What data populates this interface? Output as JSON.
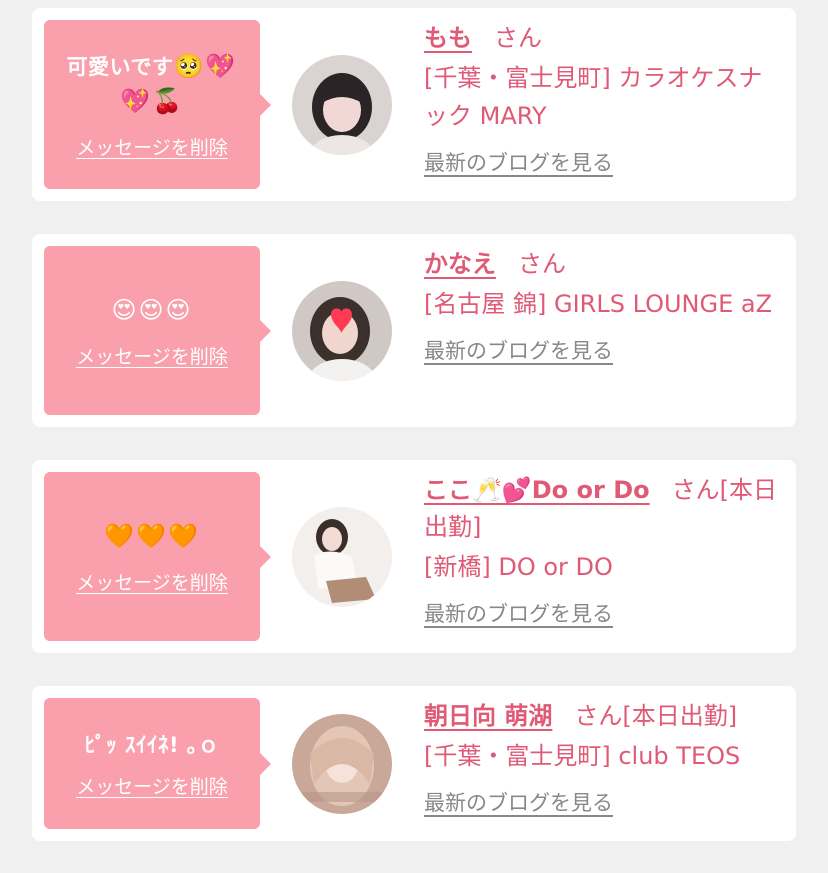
{
  "messages": [
    {
      "message_text": "可愛いです",
      "message_emoji": "🥺💖",
      "message_emoji2": "💖🍒",
      "delete_label": "メッセージを削除",
      "name": "もも",
      "honorific": "さん",
      "shop": "[千葉・富士見町] カラオケスナック MARY",
      "blog_link": "最新のブログを見る"
    },
    {
      "message_emoji": "😍😍😍",
      "delete_label": "メッセージを削除",
      "name": "かなえ",
      "honorific": "さん",
      "shop": "[名古屋 錦] GIRLS LOUNGE aZ",
      "blog_link": "最新のブログを見る"
    },
    {
      "message_emoji": "🧡🧡🧡",
      "delete_label": "メッセージを削除",
      "name": "ここ🥂💕Do or Do",
      "honorific": "さん[本日出勤]",
      "shop": "[新橋] DO or DO",
      "blog_link": "最新のブログを見る"
    },
    {
      "message_text": "ﾋﾟｯ ｽｲｲﾈ! ｡ｏ",
      "delete_label": "メッセージを削除",
      "name": "朝日向 萌湖",
      "honorific": "さん[本日出勤]",
      "shop": "[千葉・富士見町] club TEOS",
      "blog_link": "最新のブログを見る"
    }
  ],
  "colors": {
    "accent": "#e05a76",
    "bubble": "#f9a0ac",
    "link_gray": "#888888",
    "background": "#f0f0f0"
  }
}
